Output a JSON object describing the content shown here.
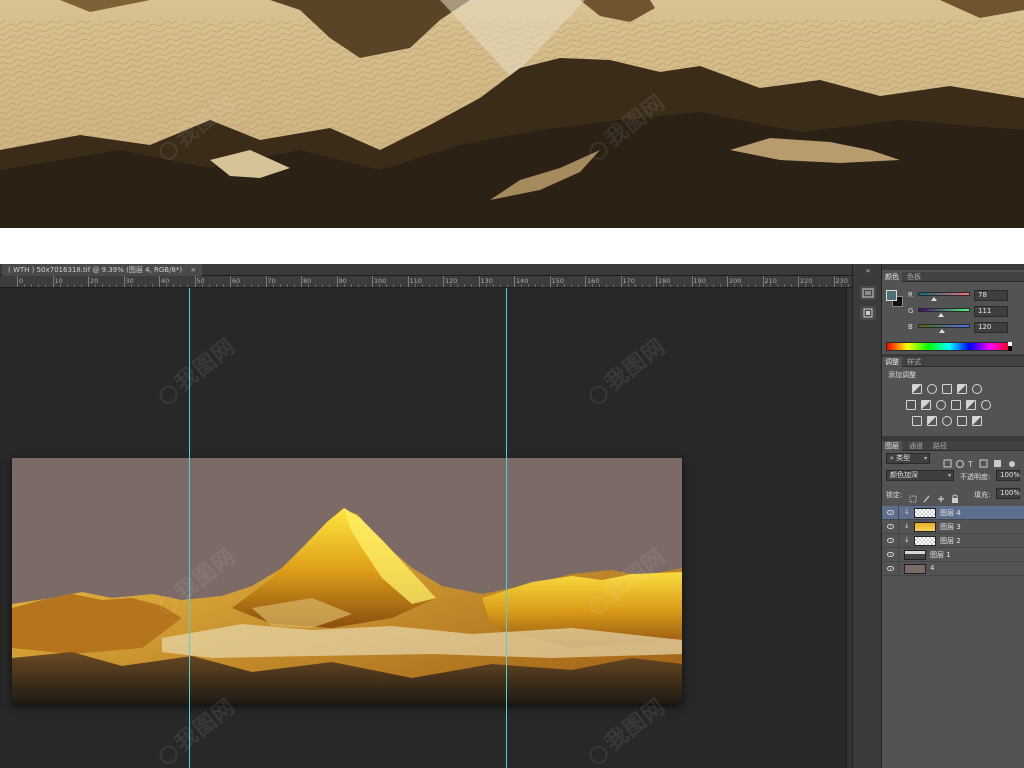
{
  "document_tab": {
    "title": "( WTH ) 50x7016318.tif @ 9.39% (图层 4, RGB/8*)",
    "close_glyph": "×"
  },
  "ruler": {
    "labels": [
      "0",
      "10",
      "20",
      "30",
      "40",
      "50",
      "60",
      "70",
      "80",
      "90",
      "100",
      "110",
      "120",
      "130",
      "140",
      "150",
      "160",
      "170",
      "180",
      "190",
      "200",
      "210",
      "220",
      "230"
    ]
  },
  "panel_collapse_glyph": "«",
  "color_panel": {
    "tabs": [
      "颜色",
      "色板"
    ],
    "foreground": "#4e6f78",
    "background": "#111111",
    "channels": [
      {
        "label": "R",
        "value": "78",
        "level": 0.306,
        "gradient": "linear-gradient(to right,#006f78,#ff6f78)"
      },
      {
        "label": "G",
        "value": "111",
        "level": 0.435,
        "gradient": "linear-gradient(to right,#4e0078,#4eff78)"
      },
      {
        "label": "B",
        "value": "120",
        "level": 0.471,
        "gradient": "linear-gradient(to right,#4e6f00,#4e6fff)"
      }
    ]
  },
  "adjustments_panel": {
    "tabs": [
      "调整",
      "样式"
    ],
    "heading": "添加调整",
    "icons": [
      "brightness-icon",
      "levels-icon",
      "curves-icon",
      "exposure-icon",
      "vibrance-icon",
      "hue-saturation-icon",
      "color-balance-icon",
      "black-white-icon",
      "photo-filter-icon",
      "channel-mixer-icon",
      "color-lookup-icon",
      "invert-icon",
      "posterize-icon",
      "threshold-icon",
      "selective-color-icon",
      "gradient-map-icon"
    ]
  },
  "layers_panel": {
    "tabs": [
      "图层",
      "通道",
      "路径"
    ],
    "filter_label": "类型",
    "blend_mode": "颜色加深",
    "opacity_label": "不透明度:",
    "opacity_value": "100%",
    "lock_label": "锁定:",
    "fill_label": "填充:",
    "fill_value": "100%",
    "layers": [
      {
        "name": "图层 4",
        "selected": true,
        "clipped": true,
        "thumb": "transparent"
      },
      {
        "name": "图层 3",
        "selected": false,
        "clipped": true,
        "thumb": "gold"
      },
      {
        "name": "图层 2",
        "selected": false,
        "clipped": true,
        "thumb": "transparent"
      },
      {
        "name": "图层 1",
        "selected": false,
        "clipped": false,
        "thumb": "mountain"
      },
      {
        "name": "4",
        "selected": false,
        "clipped": false,
        "thumb": "solid"
      }
    ]
  },
  "watermark_text": "我图网"
}
